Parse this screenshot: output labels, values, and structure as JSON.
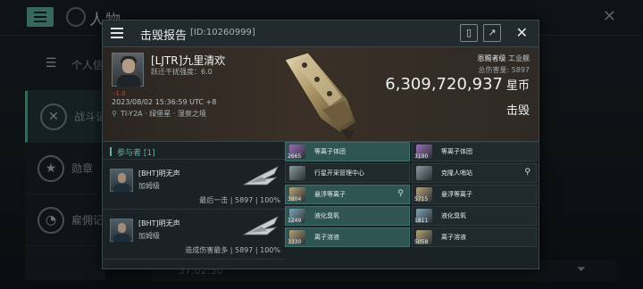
{
  "background": {
    "title": "人物",
    "sidebar": [
      {
        "label": "个人信",
        "icon": "menu-icon"
      },
      {
        "label": "战斗记",
        "icon": "combat-log-icon"
      },
      {
        "label": "勋章",
        "icon": "medal-icon"
      },
      {
        "label": "雇佣记",
        "icon": "employment-icon"
      }
    ],
    "bottom_time": "37:02:30"
  },
  "modal": {
    "title": "击毁报告",
    "id_text": "[ID:10260999]",
    "victim": {
      "name": "[LJTR]九里清欢",
      "sub": "跃迁干扰强度：6.0",
      "security_status": "-1.0",
      "timestamp": "2023/08/02 15:36:59 UTC +8",
      "location": "TI-Y2A · 绿堡星 · 湿泉之境"
    },
    "ship_class_label": "恩赐者级",
    "ship_category": "工业舰",
    "total_damage_label": "总伤害量:",
    "total_damage": "5897",
    "isk_value": "6,309,720,937",
    "isk_unit": "星币",
    "result": "击毁",
    "attackers_header": "参与者 [1]",
    "attackers": [
      {
        "name": "[BHT]明无声",
        "ship": "加姆级",
        "tag": "最后一击",
        "damage": "5897",
        "percent": "100%"
      },
      {
        "name": "[BHT]明无声",
        "ship": "加姆级",
        "tag": "造成伤害最多",
        "damage": "5897",
        "percent": "100%"
      }
    ],
    "items_header": "其他",
    "items": [
      {
        "qty": "2665",
        "name": "等离子体团",
        "dropped": true,
        "loc": "",
        "color": "#9a6fb8"
      },
      {
        "qty": "3190",
        "name": "等离子体团",
        "dropped": false,
        "loc": "",
        "color": "#9a6fb8"
      },
      {
        "qty": "",
        "name": "行星开采管理中心",
        "dropped": false,
        "loc": "",
        "color": "#8a9aa0"
      },
      {
        "qty": "",
        "name": "克隆人哨站",
        "dropped": false,
        "loc": "⚲",
        "color": "#8a9aa0"
      },
      {
        "qty": "3804",
        "name": "悬浮等离子",
        "dropped": true,
        "loc": "⚲",
        "color": "#b9a47a"
      },
      {
        "qty": "5715",
        "name": "悬浮等离子",
        "dropped": false,
        "loc": "",
        "color": "#b9a47a"
      },
      {
        "qty": "1249",
        "name": "液化臭氧",
        "dropped": true,
        "loc": "",
        "color": "#7fa6b8"
      },
      {
        "qty": "1811",
        "name": "液化臭氧",
        "dropped": false,
        "loc": "",
        "color": "#7fa6b8"
      },
      {
        "qty": "3330",
        "name": "离子溶液",
        "dropped": true,
        "loc": "",
        "color": "#b4a27a"
      },
      {
        "qty": "5058",
        "name": "离子溶液",
        "dropped": false,
        "loc": "",
        "color": "#b4a27a"
      }
    ]
  },
  "colors": {
    "accent": "#5fb3a3",
    "dropped_bg": "#2f5552",
    "security_red": "#c74b3e"
  }
}
